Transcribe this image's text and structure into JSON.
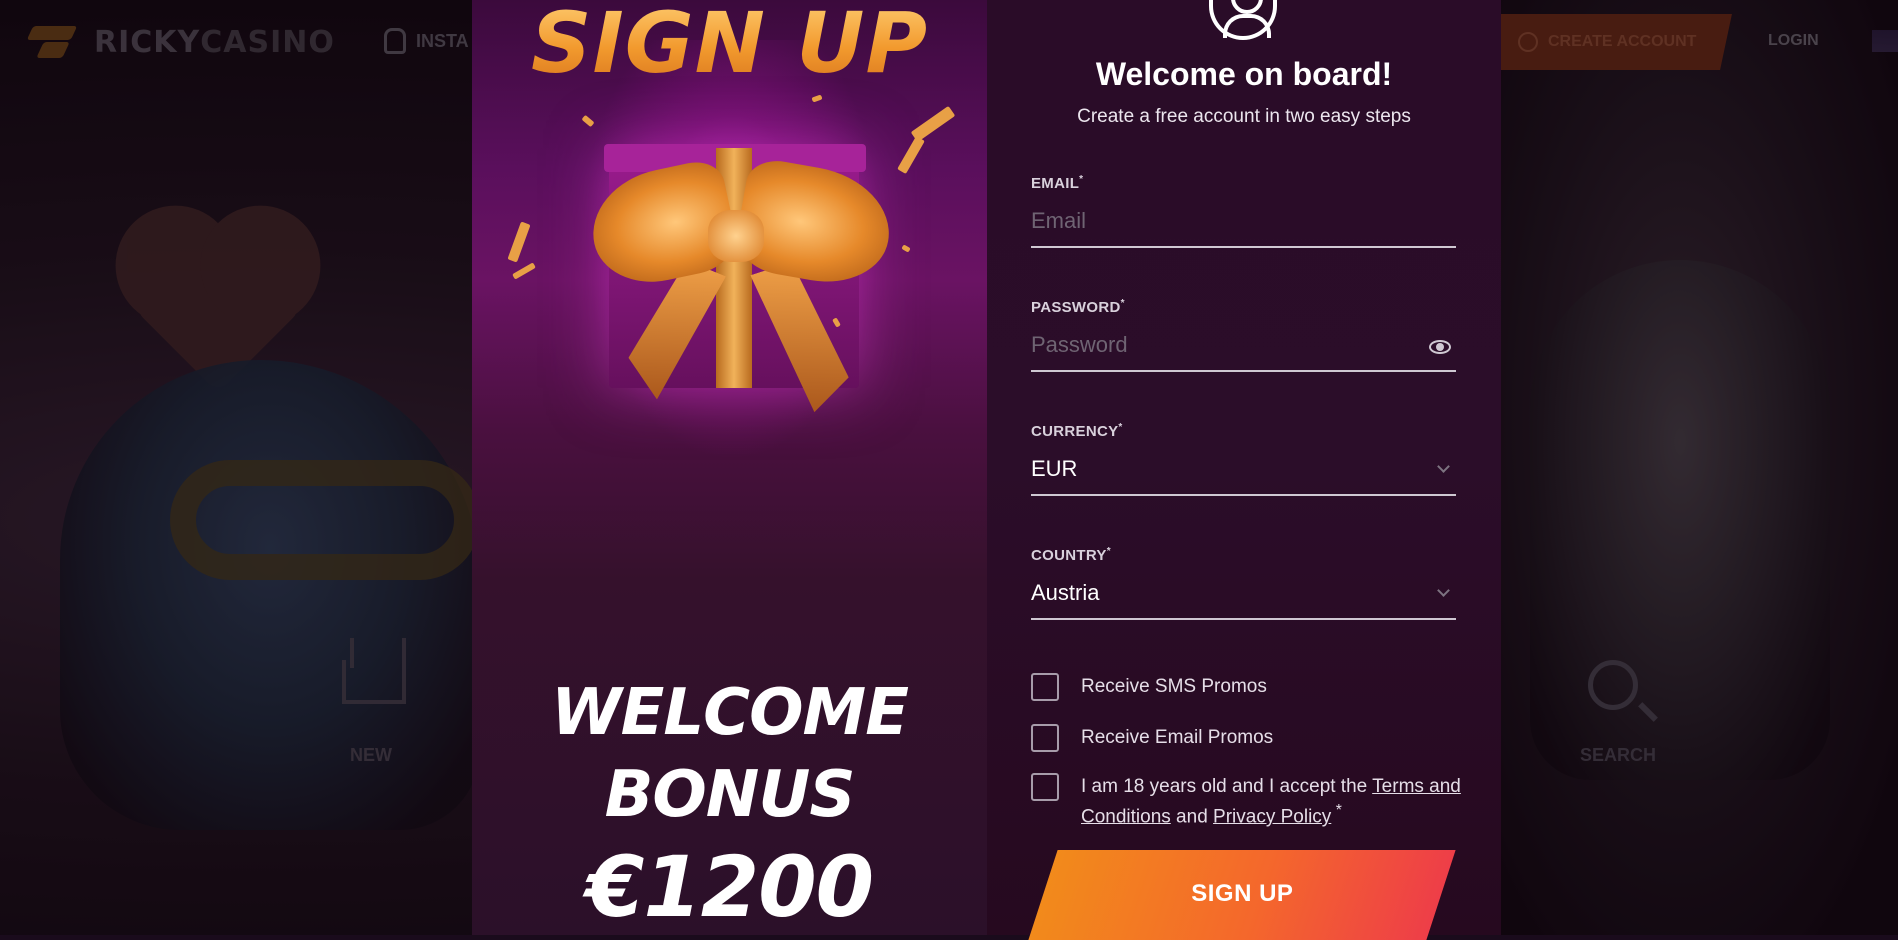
{
  "nav": {
    "logo_text_a": "RICKY",
    "logo_text_b": "CASINO",
    "install_label": "INSTA",
    "create_account_label": "CREATE ACCOUNT",
    "login_label": "LOGIN"
  },
  "background": {
    "new_label": "NEW",
    "search_label": "SEARCH"
  },
  "promo": {
    "title": "SIGN UP",
    "welcome_line1": "WELCOME",
    "welcome_line2": "BONUS",
    "amount": "€1200"
  },
  "form": {
    "title": "Welcome on board!",
    "subtitle": "Create a free account in two easy steps",
    "email": {
      "label": "EMAIL",
      "required_mark": "*",
      "placeholder": "Email",
      "value": ""
    },
    "password": {
      "label": "PASSWORD",
      "required_mark": "*",
      "placeholder": "Password",
      "value": ""
    },
    "currency": {
      "label": "CURRENCY",
      "required_mark": "*",
      "selected": "EUR"
    },
    "country": {
      "label": "COUNTRY",
      "required_mark": "*",
      "selected": "Austria"
    },
    "checkboxes": {
      "sms": "Receive SMS Promos",
      "email": "Receive Email Promos",
      "terms_prefix": "I am 18 years old and I accept the ",
      "terms_link": "Terms and Conditions",
      "terms_and": " and ",
      "privacy_link": "Privacy Policy",
      "terms_mark": " *"
    },
    "submit_label": "SIGN UP"
  },
  "colors": {
    "accent_orange": "#f28a1b",
    "accent_red": "#ee3e48",
    "gold": "#f29a2e",
    "panel_purple": "#2b0d29"
  },
  "icons": [
    "android-icon",
    "plus-circle-icon",
    "flag-icon",
    "user-icon",
    "eye-icon",
    "chevron-down-icon",
    "crown-icon",
    "search-icon"
  ]
}
